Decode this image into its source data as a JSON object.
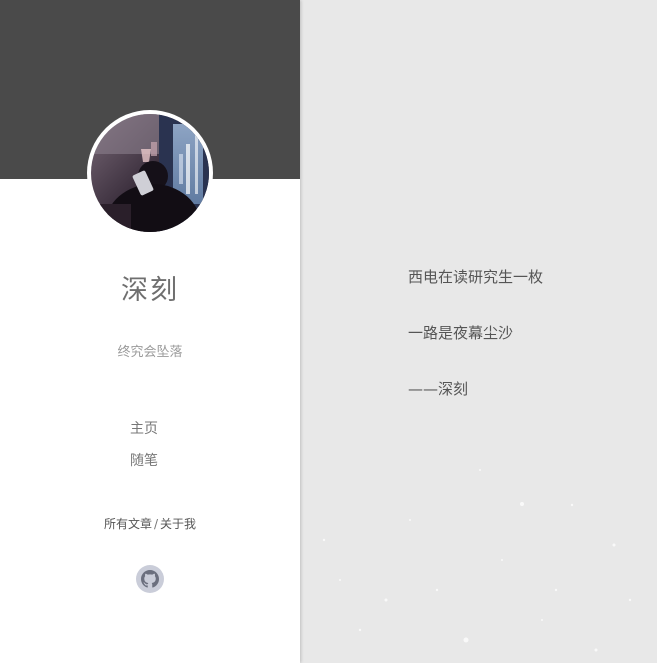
{
  "profile": {
    "name": "深刻",
    "motto": "终究会坠落",
    "avatar_icon": "avatar-photo"
  },
  "nav": {
    "items": [
      {
        "label": "主页"
      },
      {
        "label": "随笔"
      }
    ]
  },
  "links": {
    "all_posts": "所有文章",
    "separator": "/",
    "about": "关于我"
  },
  "social": {
    "github_icon": "github-icon"
  },
  "content": {
    "lines": [
      "西电在读研究生一枚",
      "一路是夜幕尘沙",
      "——深刻"
    ]
  },
  "colors": {
    "banner": "#4a4a4a",
    "sidebar": "#ffffff",
    "page_background": "#e8e8e8",
    "github_badge": "#cacdd9"
  }
}
